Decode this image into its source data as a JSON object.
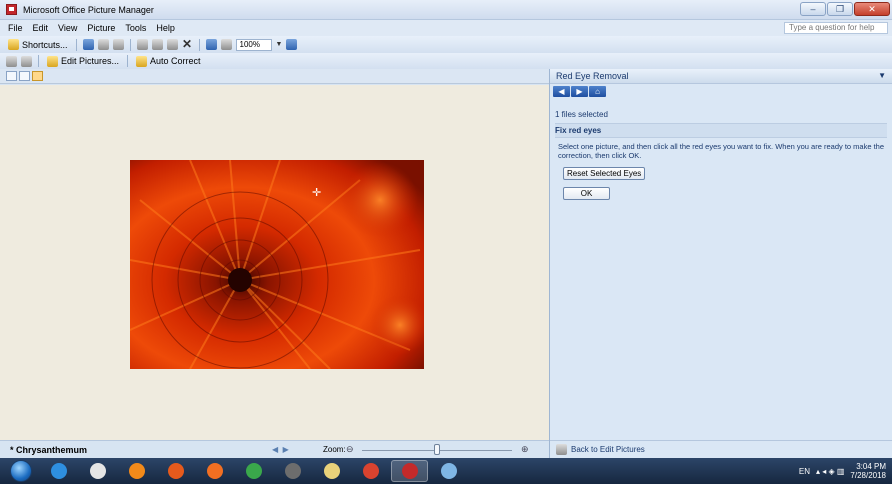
{
  "window": {
    "title": "Microsoft Office Picture Manager",
    "controls": [
      "–",
      "❐",
      "✕"
    ]
  },
  "menubar": {
    "items": [
      {
        "label": "File"
      },
      {
        "label": "Edit"
      },
      {
        "label": "View"
      },
      {
        "label": "Picture"
      },
      {
        "label": "Tools"
      },
      {
        "label": "Help"
      }
    ],
    "help_placeholder": "Type a question for help"
  },
  "toolbar1": {
    "shortcuts_label": "Shortcuts...",
    "zoom_value": "100%"
  },
  "toolbar2": {
    "edit_pictures_label": "Edit Pictures...",
    "auto_correct_label": "Auto Correct"
  },
  "status": {
    "picture_name": "* Chrysanthemum",
    "zoom_label": "Zoom:",
    "zoom_level": 0.5
  },
  "task_pane": {
    "title": "Red Eye Removal",
    "files_selected": "1 files selected",
    "section_title": "Fix red eyes",
    "instructions": "Select one picture, and then click all the red eyes you want to fix. When you are ready to make the correction, then click OK.",
    "reset_button": "Reset Selected Eyes",
    "ok_button": "OK",
    "back_link": "Back to Edit Pictures"
  },
  "taskbar": {
    "lang": "EN",
    "time": "3:04 PM",
    "date": "7/28/2018",
    "apps": [
      {
        "name": "internet-explorer-icon",
        "color": "#2e8fe0"
      },
      {
        "name": "file-explorer-icon",
        "color": "#e5e5e5"
      },
      {
        "name": "vlc-icon",
        "color": "#f28a1a"
      },
      {
        "name": "firefox-icon",
        "color": "#e65a1c"
      },
      {
        "name": "media-player-icon",
        "color": "#f26f22"
      },
      {
        "name": "chrome-legacy-icon",
        "color": "#3aa84b"
      },
      {
        "name": "paint-bucket-icon",
        "color": "#6d6d6d"
      },
      {
        "name": "notes-icon",
        "color": "#e9d27a"
      },
      {
        "name": "chrome-icon",
        "color": "#d9432f"
      },
      {
        "name": "picture-manager-icon",
        "color": "#c32a2a"
      },
      {
        "name": "paint-icon",
        "color": "#7fb6e5"
      }
    ]
  }
}
